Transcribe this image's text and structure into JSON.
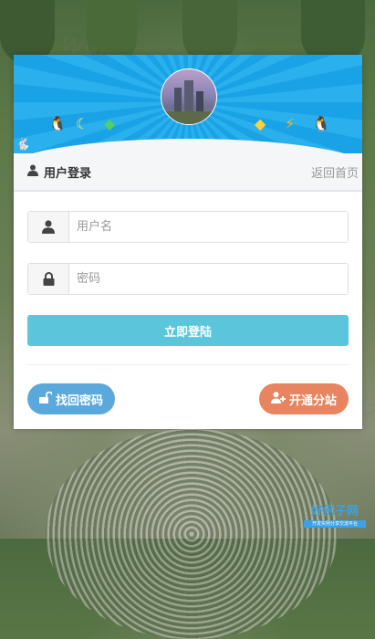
{
  "background": {
    "watermark_text": "www.haolizi.com",
    "logo_title": "好例子网",
    "logo_subtitle": "开发实例分享交流平台"
  },
  "banner": {
    "left_icons": [
      "qq-penguin-icon",
      "moon-icon",
      "green-diamond-icon"
    ],
    "right_icons": [
      "yellow-z-diamond-icon",
      "lightning-diamond-icon",
      "qq-penguin-icon"
    ]
  },
  "header": {
    "title": "用户登录",
    "back_link": "返回首页"
  },
  "form": {
    "username_placeholder": "用户名",
    "password_placeholder": "密码",
    "login_label": "立即登陆"
  },
  "footer": {
    "recover_label": "找回密码",
    "register_label": "开通分站"
  },
  "colors": {
    "banner": "#1aa2e6",
    "login_button": "#5bc6db",
    "recover_button": "#5ba9dc",
    "register_button": "#e8845f"
  }
}
